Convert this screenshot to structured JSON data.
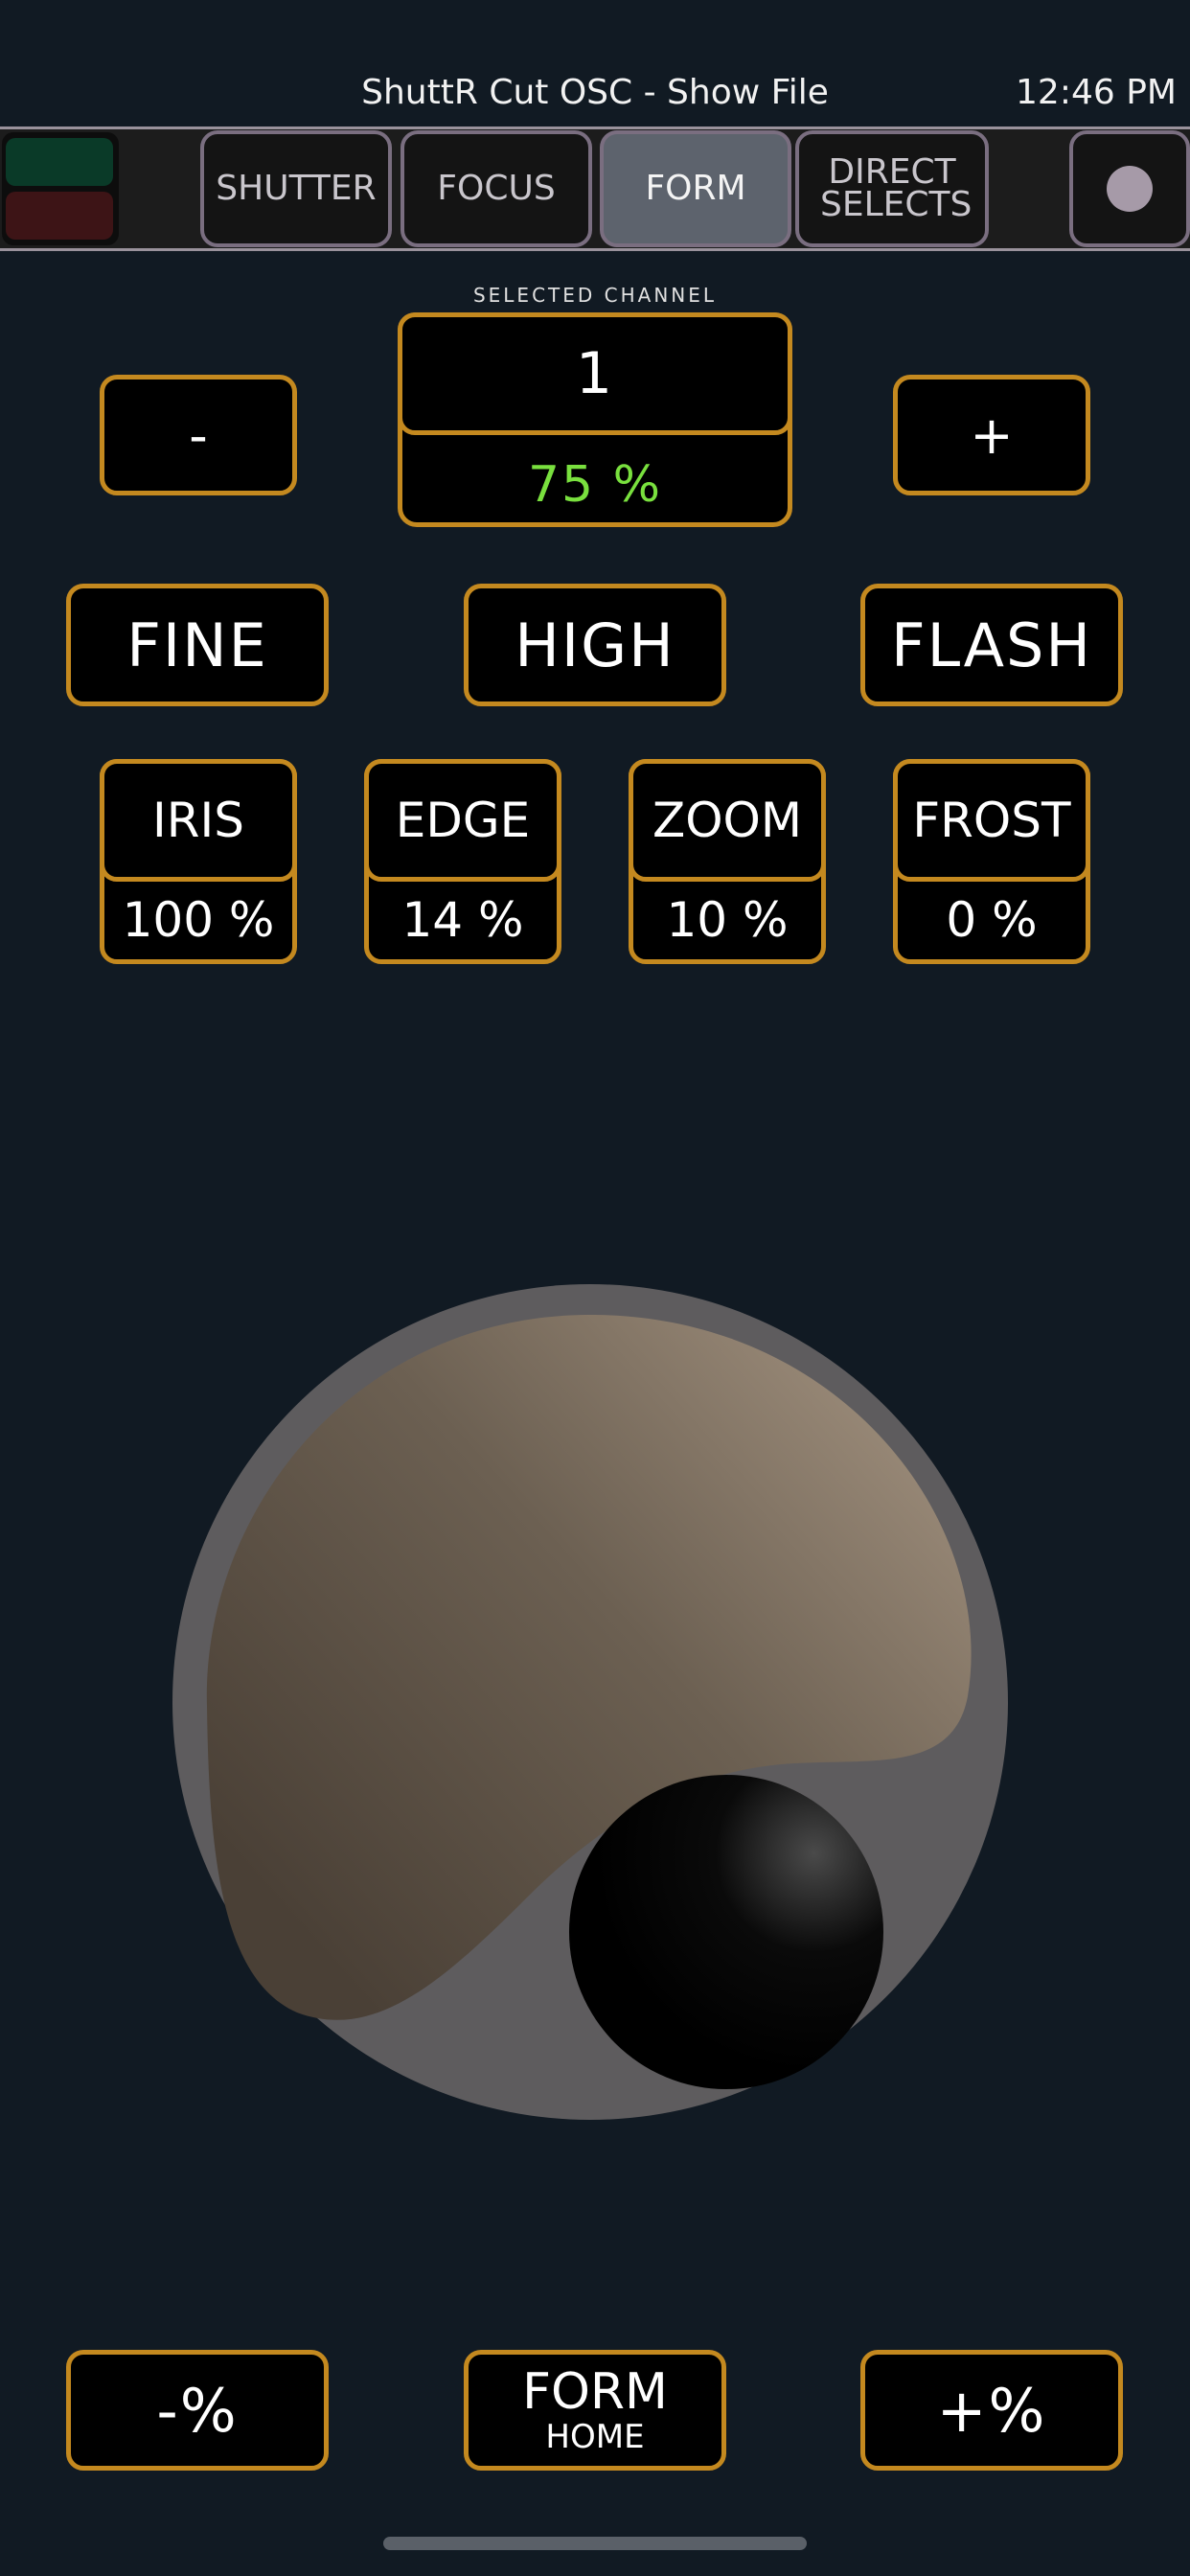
{
  "header": {
    "title": "ShuttR Cut OSC - Show File",
    "time": "12:46 PM"
  },
  "tabs": [
    {
      "label": "SHUTTER",
      "active": false
    },
    {
      "label": "FOCUS",
      "active": false
    },
    {
      "label": "FORM",
      "active": true
    },
    {
      "label": "DIRECT SELECTS",
      "active": false
    }
  ],
  "channel": {
    "section_label": "SELECTED CHANNEL",
    "number": "1",
    "level": "75 %",
    "minus_label": "-",
    "plus_label": "+"
  },
  "modes": {
    "fine": "FINE",
    "high": "HIGH",
    "flash": "FLASH"
  },
  "params": [
    {
      "label": "IRIS",
      "value": "100 %"
    },
    {
      "label": "EDGE",
      "value": "14 %"
    },
    {
      "label": "ZOOM",
      "value": "10 %"
    },
    {
      "label": "FROST",
      "value": "0 %"
    }
  ],
  "footer": {
    "minus_percent": "-%",
    "form_home_top": "FORM",
    "form_home_bottom": "HOME",
    "plus_percent": "+%"
  },
  "colors": {
    "background": "#111a23",
    "accent": "#c4891f",
    "level_green": "#79e03e",
    "status_green": "#0a3a28",
    "status_red": "#3d1416"
  }
}
